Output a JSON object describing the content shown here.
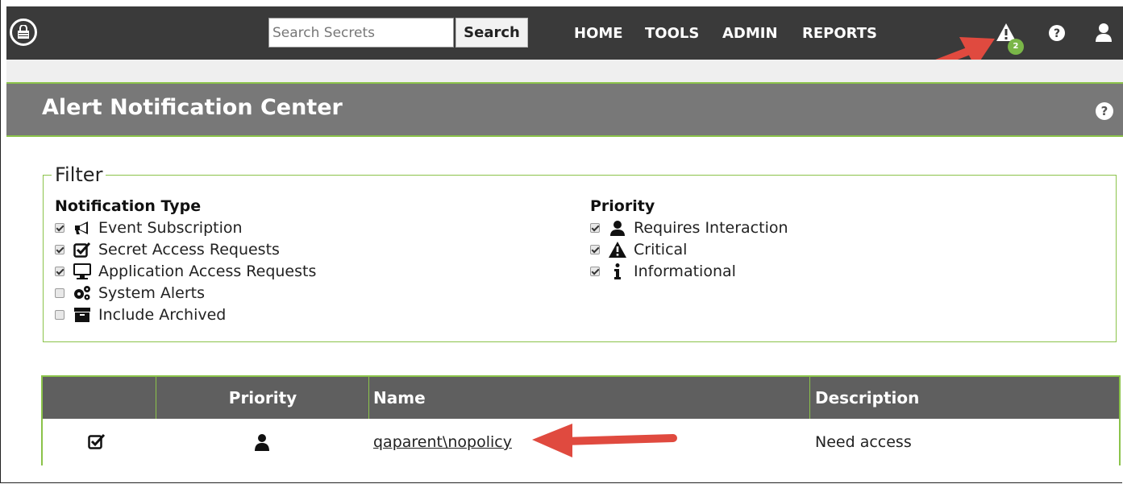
{
  "nav": {
    "search_placeholder": "Search Secrets",
    "search_button": "Search",
    "links": [
      "HOME",
      "TOOLS",
      "ADMIN",
      "REPORTS"
    ],
    "alert_badge_count": "2"
  },
  "header": {
    "title": "Alert Notification Center"
  },
  "filter": {
    "legend": "Filter",
    "notification_type": {
      "title": "Notification Type",
      "items": [
        {
          "label": "Event Subscription",
          "checked": true,
          "icon": "megaphone-icon"
        },
        {
          "label": "Secret Access Requests",
          "checked": true,
          "icon": "checkbox-icon"
        },
        {
          "label": "Application Access Requests",
          "checked": true,
          "icon": "monitor-icon"
        },
        {
          "label": "System Alerts",
          "checked": false,
          "icon": "gears-icon"
        },
        {
          "label": "Include Archived",
          "checked": false,
          "icon": "archive-icon"
        }
      ]
    },
    "priority": {
      "title": "Priority",
      "items": [
        {
          "label": "Requires Interaction",
          "checked": true,
          "icon": "user-icon"
        },
        {
          "label": "Critical",
          "checked": true,
          "icon": "warning-icon"
        },
        {
          "label": "Informational",
          "checked": true,
          "icon": "info-icon"
        }
      ]
    }
  },
  "table": {
    "headers": [
      "",
      "Priority",
      "Name",
      "Description"
    ],
    "rows": [
      {
        "name": "qaparent\\nopolicy",
        "description": "Need access",
        "priority_icon": "user-icon",
        "type_icon": "checkbox-icon"
      }
    ]
  },
  "colors": {
    "nav_bg": "#3a3a3a",
    "header_bg": "#787878",
    "accent": "#8bc34a",
    "badge": "#7ab648",
    "arrow": "#e04a3f"
  }
}
